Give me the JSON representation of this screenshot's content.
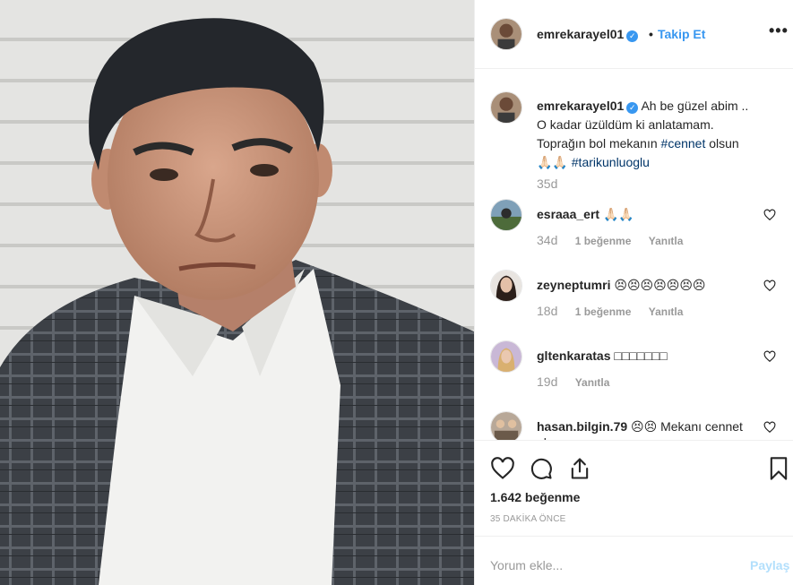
{
  "post": {
    "username": "emrekarayel01",
    "verified_mark": "✓",
    "dot": "•",
    "follow_label": "Takip Et",
    "more_label": "•••",
    "caption_text_1": "Ah be güzel abim ..",
    "caption_text_2": "O kadar üzüldüm ki anlatamam.",
    "caption_text_3": "Toprağın bol mekanın ",
    "hashtag_1": "#cennet",
    "caption_text_4": " olsun",
    "caption_emoji": "🙏🏻🙏🏻",
    "hashtag_2": "#tarikunluoglu",
    "caption_time": "35d"
  },
  "comments": [
    {
      "username": "esraaa_ert",
      "text": "🙏🏻🙏🏻",
      "time": "34d",
      "likes": "1 beğenme",
      "reply": "Yanıtla"
    },
    {
      "username": "zeyneptumri",
      "text": "😣😣😣😣😣😣😣",
      "time": "18d",
      "likes": "1 beğenme",
      "reply": "Yanıtla"
    },
    {
      "username": "gltenkaratas",
      "text": "□□□□□□□",
      "time": "19d",
      "likes": "",
      "reply": "Yanıtla"
    },
    {
      "username": "hasan.bilgin.79",
      "text": "😣😣 Mekanı cennet olsun",
      "time": "",
      "likes": "",
      "reply": ""
    }
  ],
  "footer": {
    "likes": "1.642 beğenme",
    "time_ago": "35 DAKİKA ÖNCE",
    "comment_placeholder": "Yorum ekle...",
    "share_label": "Paylaş"
  },
  "icons": {
    "like": "heart-icon",
    "comment": "comment-icon",
    "share": "share-icon",
    "save": "bookmark-icon",
    "comment_like": "heart-icon"
  },
  "colors": {
    "link": "#3897f0",
    "hashtag": "#003569",
    "muted": "#999999",
    "share_disabled": "#b2dffc"
  }
}
